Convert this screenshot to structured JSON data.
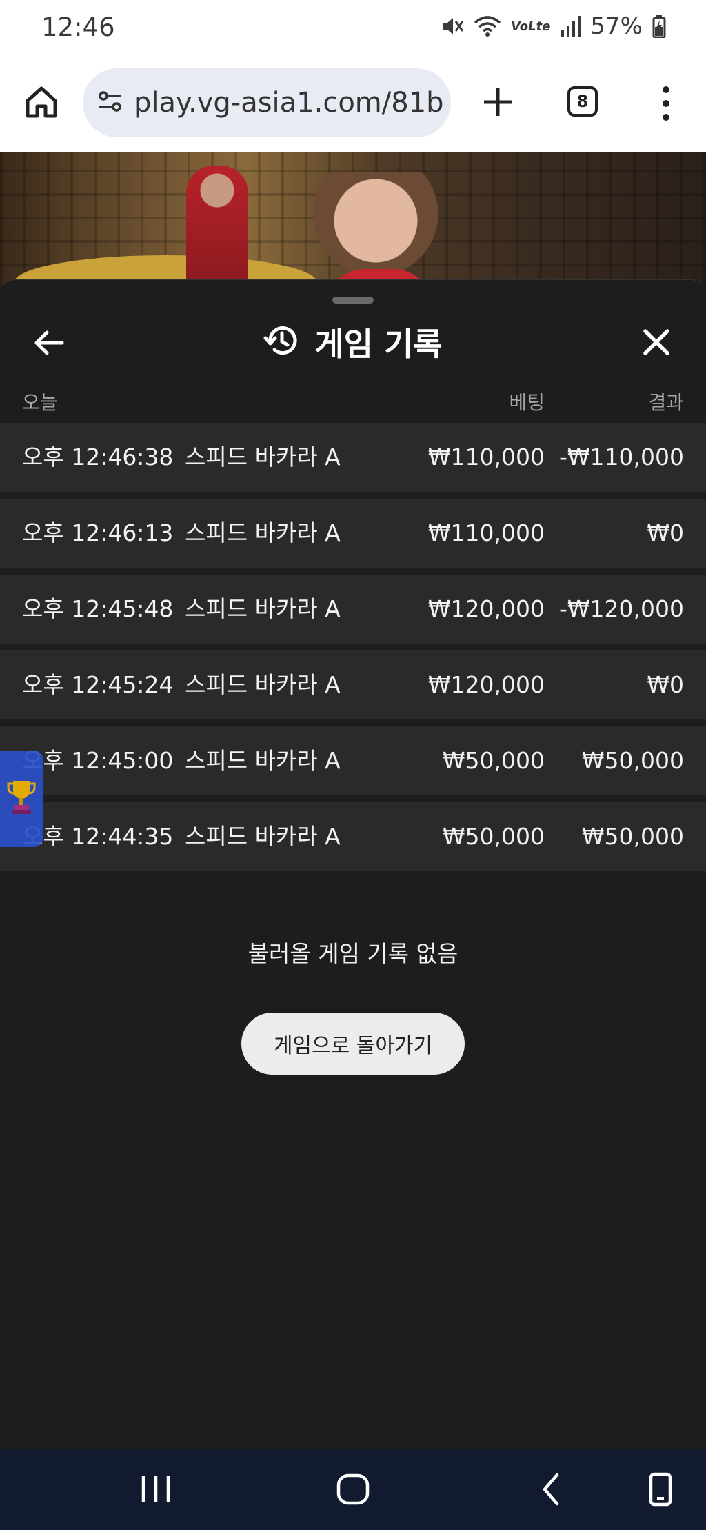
{
  "status_bar": {
    "time": "12:46",
    "battery": "57%"
  },
  "browser": {
    "url": "play.vg-asia1.com/81b",
    "tab_count": "8"
  },
  "sheet": {
    "title": "게임 기록",
    "columns": {
      "date": "오늘",
      "bet": "베팅",
      "result": "결과"
    },
    "rows": [
      {
        "time": "오후 12:46:38",
        "game": "스피드 바카라 A",
        "bet": "₩110,000",
        "result": "-₩110,000"
      },
      {
        "time": "오후 12:46:13",
        "game": "스피드 바카라 A",
        "bet": "₩110,000",
        "result": "₩0"
      },
      {
        "time": "오후 12:45:48",
        "game": "스피드 바카라 A",
        "bet": "₩120,000",
        "result": "-₩120,000"
      },
      {
        "time": "오후 12:45:24",
        "game": "스피드 바카라 A",
        "bet": "₩120,000",
        "result": "₩0"
      },
      {
        "time": "오후 12:45:00",
        "game": "스피드 바카라 A",
        "bet": "₩50,000",
        "result": "₩50,000"
      },
      {
        "time": "오후 12:44:35",
        "game": "스피드 바카라 A",
        "bet": "₩50,000",
        "result": "₩50,000"
      }
    ],
    "empty_message": "불러올 게임 기록 없음",
    "return_button": "게임으로 돌아가기"
  },
  "icons": {
    "home": "home-icon",
    "site_settings": "tune-icon",
    "new_tab": "plus-icon",
    "menu": "more-vert-icon",
    "back": "arrow-left-icon",
    "history": "history-icon",
    "close": "close-icon",
    "trophy": "trophy-icon",
    "nav_recents": "recents-icon",
    "nav_home": "nav-home-icon",
    "nav_back": "nav-back-icon",
    "nav_assist": "phone-icon"
  },
  "colors": {
    "sheet_bg": "#1d1d1d",
    "row_bg": "#2a2a2a",
    "nav_bg": "#111a2e",
    "trophy_tab": "#2b51c8"
  }
}
